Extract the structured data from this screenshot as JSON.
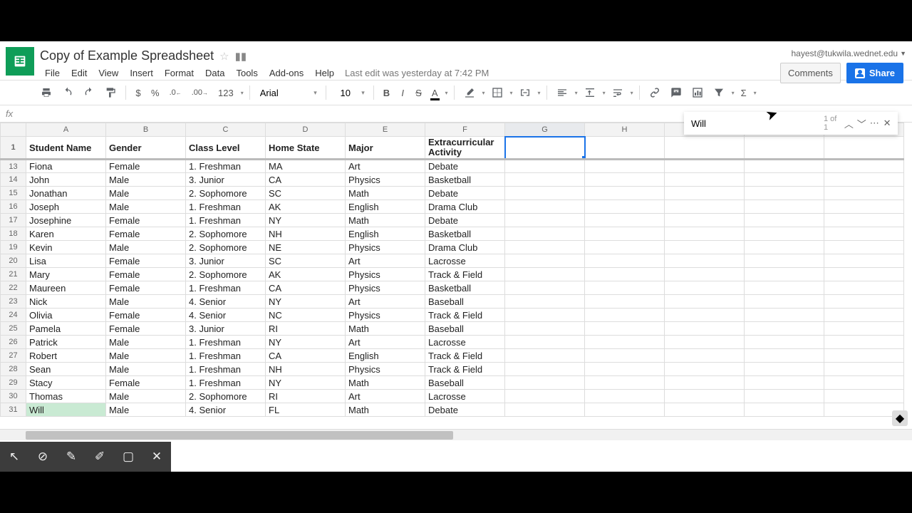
{
  "doc_title": "Copy of Example Spreadsheet",
  "account_email": "hayest@tukwila.wednet.edu",
  "menu": {
    "file": "File",
    "edit": "Edit",
    "view": "View",
    "insert": "Insert",
    "format": "Format",
    "data": "Data",
    "tools": "Tools",
    "addons": "Add-ons",
    "help": "Help",
    "lastedit": "Last edit was yesterday at 7:42 PM"
  },
  "buttons": {
    "comments": "Comments",
    "share": "Share"
  },
  "toolbar": {
    "font": "Arial",
    "size": "10",
    "currency": "$",
    "percent": "%",
    "dec_dec": ".0",
    "dec_inc": ".00",
    "num_fmt": "123"
  },
  "find": {
    "value": "Will",
    "count": "1 of 1"
  },
  "col_headers": [
    "A",
    "B",
    "C",
    "D",
    "E",
    "F",
    "G",
    "H"
  ],
  "header_row": [
    "Student Name",
    "Gender",
    "Class Level",
    "Home State",
    "Major",
    "Extracurricular Activity"
  ],
  "frozen_row_number": "1",
  "row_numbers": [
    "13",
    "14",
    "15",
    "16",
    "17",
    "18",
    "19",
    "20",
    "21",
    "22",
    "23",
    "24",
    "25",
    "26",
    "27",
    "28",
    "29",
    "30",
    "31"
  ],
  "rows": [
    [
      "Fiona",
      "Female",
      "1. Freshman",
      "MA",
      "Art",
      "Debate"
    ],
    [
      "John",
      "Male",
      "3. Junior",
      "CA",
      "Physics",
      "Basketball"
    ],
    [
      "Jonathan",
      "Male",
      "2. Sophomore",
      "SC",
      "Math",
      "Debate"
    ],
    [
      "Joseph",
      "Male",
      "1. Freshman",
      "AK",
      "English",
      "Drama Club"
    ],
    [
      "Josephine",
      "Female",
      "1. Freshman",
      "NY",
      "Math",
      "Debate"
    ],
    [
      "Karen",
      "Female",
      "2. Sophomore",
      "NH",
      "English",
      "Basketball"
    ],
    [
      "Kevin",
      "Male",
      "2. Sophomore",
      "NE",
      "Physics",
      "Drama Club"
    ],
    [
      "Lisa",
      "Female",
      "3. Junior",
      "SC",
      "Art",
      "Lacrosse"
    ],
    [
      "Mary",
      "Female",
      "2. Sophomore",
      "AK",
      "Physics",
      "Track & Field"
    ],
    [
      "Maureen",
      "Female",
      "1. Freshman",
      "CA",
      "Physics",
      "Basketball"
    ],
    [
      "Nick",
      "Male",
      "4. Senior",
      "NY",
      "Art",
      "Baseball"
    ],
    [
      "Olivia",
      "Female",
      "4. Senior",
      "NC",
      "Physics",
      "Track & Field"
    ],
    [
      "Pamela",
      "Female",
      "3. Junior",
      "RI",
      "Math",
      "Baseball"
    ],
    [
      "Patrick",
      "Male",
      "1. Freshman",
      "NY",
      "Art",
      "Lacrosse"
    ],
    [
      "Robert",
      "Male",
      "1. Freshman",
      "CA",
      "English",
      "Track & Field"
    ],
    [
      "Sean",
      "Male",
      "1. Freshman",
      "NH",
      "Physics",
      "Track & Field"
    ],
    [
      "Stacy",
      "Female",
      "1. Freshman",
      "NY",
      "Math",
      "Baseball"
    ],
    [
      "Thomas",
      "Male",
      "2. Sophomore",
      "RI",
      "Art",
      "Lacrosse"
    ],
    [
      "Will",
      "Male",
      "4. Senior",
      "FL",
      "Math",
      "Debate"
    ]
  ],
  "highlight_row_index": 18,
  "selected_col": "G"
}
